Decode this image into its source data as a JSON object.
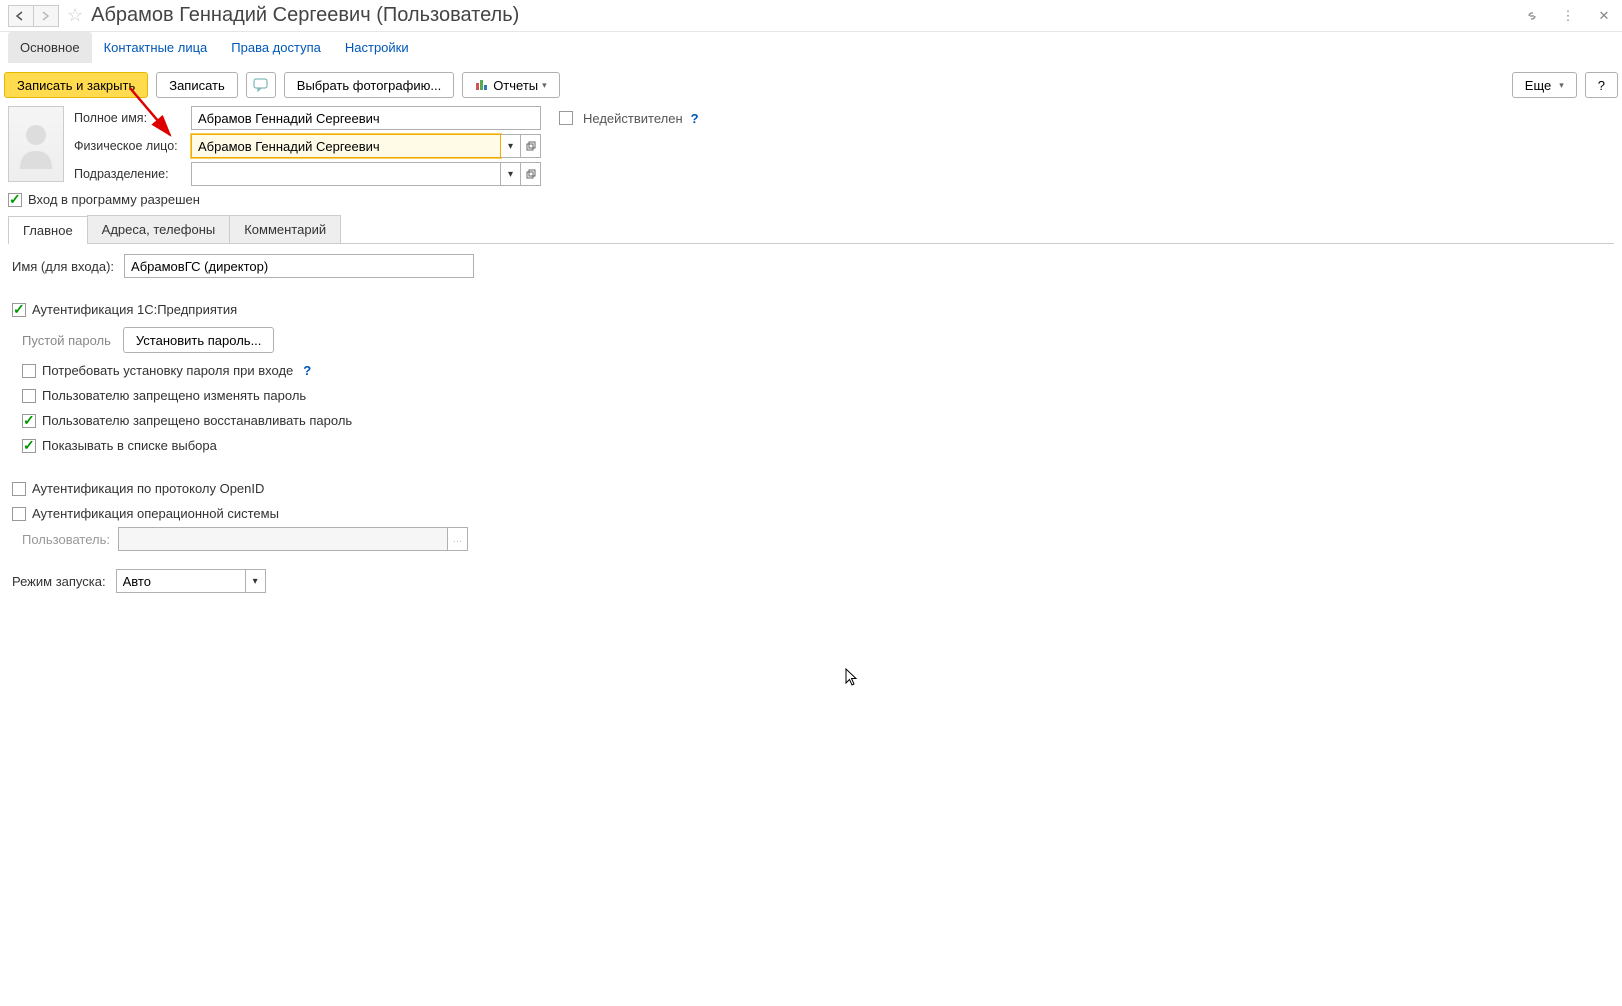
{
  "header": {
    "title": "Абрамов Геннадий Сергеевич (Пользователь)"
  },
  "mainNav": {
    "tabs": [
      "Основное",
      "Контактные лица",
      "Права доступа",
      "Настройки"
    ],
    "activeIdx": 0
  },
  "toolbar": {
    "saveClose": "Записать и закрыть",
    "save": "Записать",
    "choosePhoto": "Выбрать фотографию...",
    "reports": "Отчеты",
    "more": "Еще",
    "help": "?"
  },
  "fields": {
    "fullNameLabel": "Полное имя:",
    "fullName": "Абрамов Геннадий Сергеевич",
    "invalidLabel": "Недействителен",
    "personLabel": "Физическое лицо:",
    "person": "Абрамов Геннадий Сергеевич",
    "deptLabel": "Подразделение:",
    "dept": "",
    "allowLoginLabel": "Вход в программу разрешен",
    "allowLogin": true
  },
  "tabs2": {
    "items": [
      "Главное",
      "Адреса, телефоны",
      "Комментарий"
    ],
    "activeIdx": 0
  },
  "main": {
    "loginLabel": "Имя (для входа):",
    "login": "АбрамовГС (директор)",
    "auth1cLabel": "Аутентификация 1С:Предприятия",
    "auth1c": true,
    "emptyPwd": "Пустой пароль",
    "setPwdBtn": "Установить пароль...",
    "requireChangeLabel": "Потребовать установку пароля при входе",
    "requireChange": false,
    "noChangeLabel": "Пользователю запрещено изменять пароль",
    "noChange": false,
    "noRestoreLabel": "Пользователю запрещено восстанавливать пароль",
    "noRestore": true,
    "showInListLabel": "Показывать в списке выбора",
    "showInList": true,
    "openIdLabel": "Аутентификация по протоколу OpenID",
    "openId": false,
    "osAuthLabel": "Аутентификация операционной системы",
    "osAuth": false,
    "osUserLabel": "Пользователь:",
    "osUser": "",
    "launchLabel": "Режим запуска:",
    "launch": "Авто"
  }
}
